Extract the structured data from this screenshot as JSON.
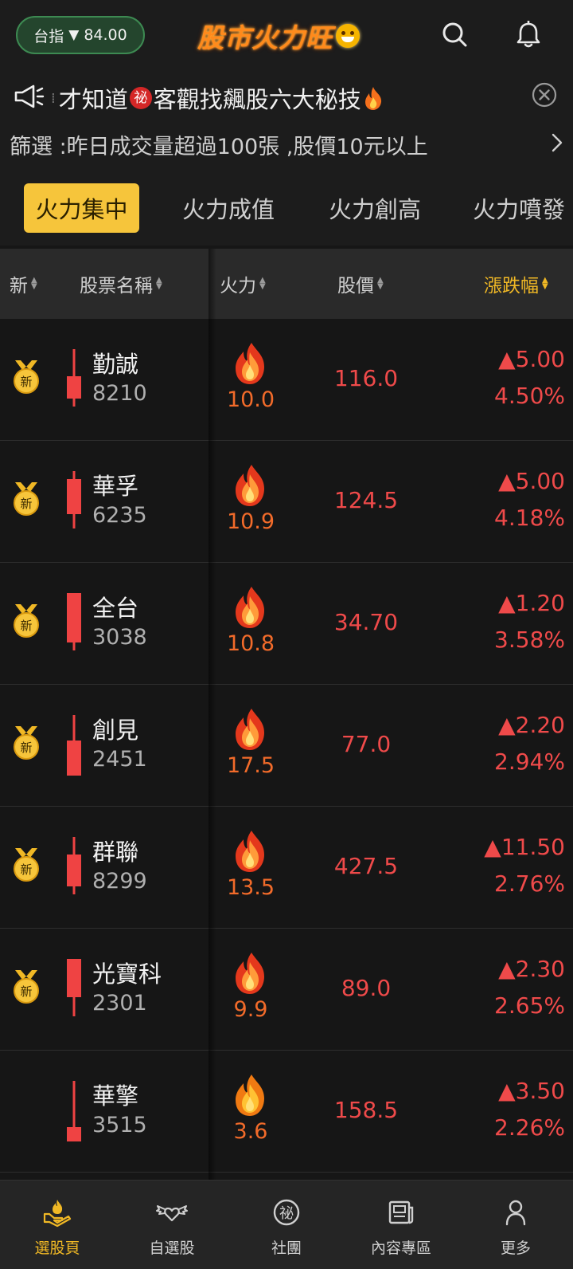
{
  "header": {
    "index_label": "台指",
    "index_change": "84.00",
    "logo_text": "股市火力旺"
  },
  "promo": {
    "text_a": "才知道",
    "secret_badge": "祕",
    "text_b": "客觀找飆股六大秘技"
  },
  "filter": {
    "text": "篩選 :昨日成交量超過100張 ,股價10元以上"
  },
  "tabs": [
    {
      "label": "火力集中",
      "active": true
    },
    {
      "label": "火力成值",
      "active": false
    },
    {
      "label": "火力創高",
      "active": false
    },
    {
      "label": "火力噴發",
      "active": false
    }
  ],
  "table": {
    "headers": {
      "new": "新",
      "name": "股票名稱",
      "fire": "火力",
      "price": "股價",
      "change": "漲跌幅"
    },
    "rows": [
      {
        "new_badge": "新",
        "name": "勤誠",
        "code": "8210",
        "fire": "10.0",
        "price": "116.0",
        "change": "5.00",
        "pct": "4.50%"
      },
      {
        "new_badge": "新",
        "name": "華孚",
        "code": "6235",
        "fire": "10.9",
        "price": "124.5",
        "change": "5.00",
        "pct": "4.18%"
      },
      {
        "new_badge": "新",
        "name": "全台",
        "code": "3038",
        "fire": "10.8",
        "price": "34.70",
        "change": "1.20",
        "pct": "3.58%"
      },
      {
        "new_badge": "新",
        "name": "創見",
        "code": "2451",
        "fire": "17.5",
        "price": "77.0",
        "change": "2.20",
        "pct": "2.94%"
      },
      {
        "new_badge": "新",
        "name": "群聯",
        "code": "8299",
        "fire": "13.5",
        "price": "427.5",
        "change": "11.50",
        "pct": "2.76%"
      },
      {
        "new_badge": "新",
        "name": "光寶科",
        "code": "2301",
        "fire": "9.9",
        "price": "89.0",
        "change": "2.30",
        "pct": "2.65%"
      },
      {
        "new_badge": "",
        "name": "華擎",
        "code": "3515",
        "fire": "3.6",
        "price": "158.5",
        "change": "3.50",
        "pct": "2.26%"
      }
    ]
  },
  "bottom_nav": [
    {
      "label": "選股頁",
      "icon": "hand-flame-icon",
      "active": true
    },
    {
      "label": "自選股",
      "icon": "winged-heart-icon",
      "active": false
    },
    {
      "label": "社團",
      "icon": "secret-circle-icon",
      "active": false
    },
    {
      "label": "內容專區",
      "icon": "newspaper-icon",
      "active": false
    },
    {
      "label": "更多",
      "icon": "person-icon",
      "active": false
    }
  ],
  "colors": {
    "accent": "#f6c53b",
    "up_red": "#ef4a4a",
    "fire_orange": "#f26b2a",
    "background": "#161616"
  }
}
